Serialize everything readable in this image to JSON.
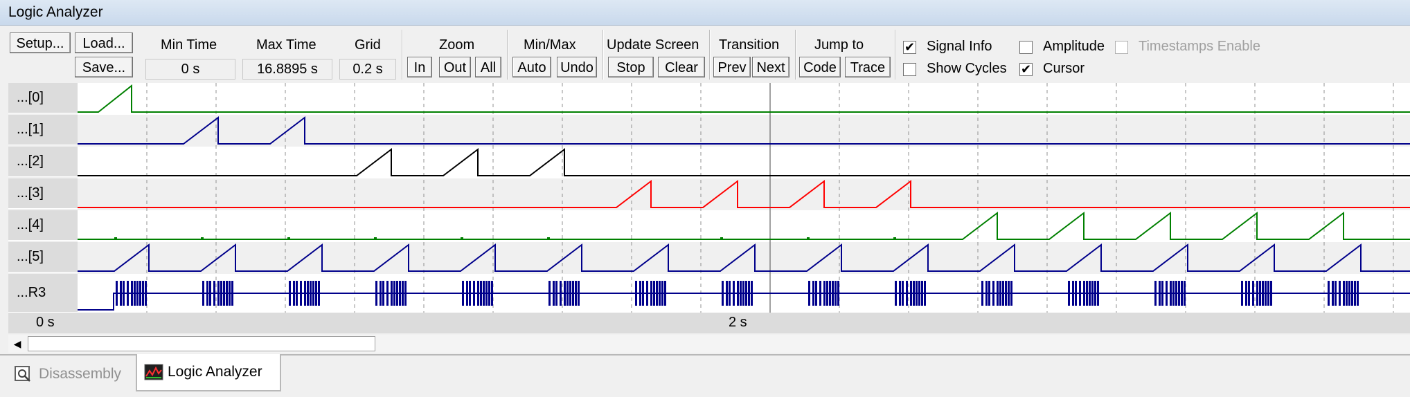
{
  "window": {
    "title": "Logic Analyzer"
  },
  "toolbar": {
    "setup_label": "Setup...",
    "load_label": "Load...",
    "save_label": "Save...",
    "min_time_label": "Min Time",
    "min_time_value": "0 s",
    "max_time_label": "Max Time",
    "max_time_value": "16.8895 s",
    "grid_label": "Grid",
    "grid_value": "0.2 s",
    "zoom_label": "Zoom",
    "zoom_in": "In",
    "zoom_out": "Out",
    "zoom_all": "All",
    "minmax_label": "Min/Max",
    "auto_label": "Auto",
    "undo_label": "Undo",
    "update_label": "Update Screen",
    "stop_label": "Stop",
    "clear_label": "Clear",
    "transition_label": "Transition",
    "prev_label": "Prev",
    "next_label": "Next",
    "jump_label": "Jump to",
    "code_label": "Code",
    "trace_label": "Trace",
    "signal_info": {
      "label": "Signal Info",
      "checked": true
    },
    "show_cycles": {
      "label": "Show Cycles",
      "checked": false
    },
    "amplitude": {
      "label": "Amplitude",
      "checked": false
    },
    "cursor": {
      "label": "Cursor",
      "checked": true
    },
    "timestamps": {
      "label": "Timestamps Enable",
      "checked": false,
      "enabled": false
    }
  },
  "signals": [
    {
      "name": "...[0]",
      "color": "#008000"
    },
    {
      "name": "...[1]",
      "color": "#00008b"
    },
    {
      "name": "...[2]",
      "color": "#000000"
    },
    {
      "name": "...[3]",
      "color": "#ff0000"
    },
    {
      "name": "...[4]",
      "color": "#008000"
    },
    {
      "name": "...[5]",
      "color": "#00008b"
    },
    {
      "name": "...R3",
      "color": "#00008b"
    }
  ],
  "time_axis": {
    "start_label": "0 s",
    "mid_label": "2 s"
  },
  "tabs": [
    {
      "label": "Disassembly",
      "active": false,
      "icon": "disassembly-icon"
    },
    {
      "label": "Logic Analyzer",
      "active": true,
      "icon": "logic-analyzer-icon"
    }
  ]
}
